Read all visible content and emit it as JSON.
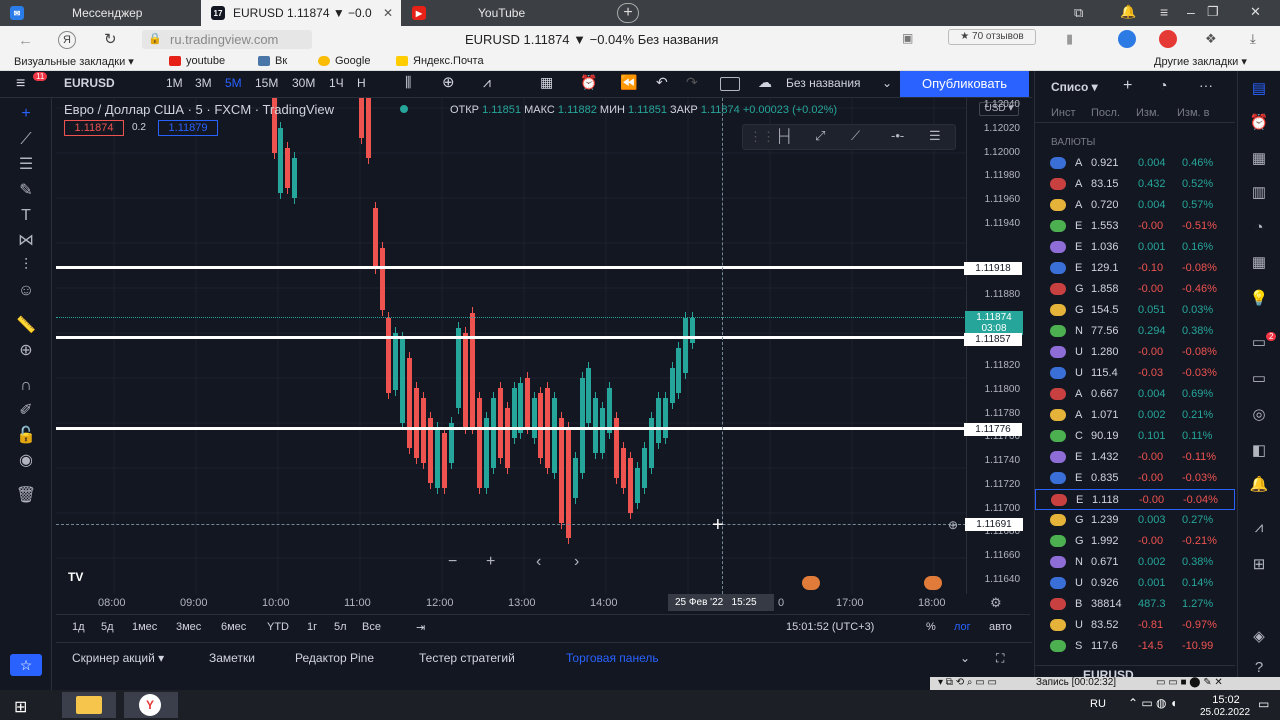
{
  "browser": {
    "tabs": [
      {
        "label": "Мессенджер",
        "active": false
      },
      {
        "label": "EURUSD 1.11874 ▼ −0.0",
        "active": true
      },
      {
        "label": "YouTube",
        "active": false
      }
    ],
    "url": "ru.tradingview.com",
    "page_title": "EURUSD 1.11874 ▼ −0.04% Без названия",
    "reviews": "★ 70 отзывов",
    "bookmarks": [
      "Визуальные закладки ▾",
      "youtube",
      "Вк",
      "Google",
      "Яндекс.Почта"
    ],
    "other_bookmarks": "Другие закладки ▾"
  },
  "toolbar": {
    "symbol": "EURUSD",
    "intervals": [
      "1M",
      "3M",
      "5M",
      "15M",
      "30M",
      "1Ч",
      "Н"
    ],
    "active_interval": "5M",
    "layout_name": "Без названия",
    "publish_label": "Опубликовать",
    "notif_badge": "11"
  },
  "legend": {
    "title": "Евро / Доллар США · 5 · FXCM · TradingView",
    "open_label": "ОТКР",
    "open": "1.11851",
    "high_label": "МАКС",
    "high": "1.11882",
    "low_label": "МИН",
    "low": "1.11851",
    "close_label": "ЗАКР",
    "close": "1.11874",
    "change": "+0.00023 (+0.02%)",
    "bid": "1.11874",
    "spread": "0.2",
    "ask": "1.11879"
  },
  "price_axis": {
    "currency": "USD ▾",
    "labels": [
      "1.12040",
      "1.12020",
      "1.12000",
      "1.11980",
      "1.11960",
      "1.11940",
      "1.11900",
      "1.11880",
      "1.11840",
      "1.11820",
      "1.11800",
      "1.11780",
      "1.11760",
      "1.11740",
      "1.11720",
      "1.11700",
      "1.11680",
      "1.11660",
      "1.11640"
    ],
    "current_price": "1.11874",
    "countdown": "03:08",
    "crosshair_price": "1.11691",
    "level_labels": [
      "1.11918",
      "1.11857",
      "1.11776"
    ]
  },
  "time_axis": {
    "labels": [
      "08:00",
      "09:00",
      "10:00",
      "11:00",
      "12:00",
      "13:00",
      "14:00",
      "0",
      "17:00",
      "18:00"
    ],
    "cursor_date": "25 Фев '22",
    "cursor_time": "15:25"
  },
  "range_bar": {
    "ranges": [
      "1д",
      "5д",
      "1мес",
      "3мес",
      "6мес",
      "YTD",
      "1г",
      "5л",
      "Все"
    ],
    "clock": "15:01:52 (UTC+3)",
    "percent": "%",
    "log": "лог",
    "auto": "авто"
  },
  "bottom_tabs": [
    "Скринер акций ▾",
    "Заметки",
    "Редактор Pine",
    "Тестер стратегий",
    "Торговая панель"
  ],
  "watchlist": {
    "title": "Списо ▾",
    "columns": [
      "Инст",
      "Посл.",
      "Изм.",
      "Изм. в"
    ],
    "section": "ВАЛЮТЫ",
    "rows": [
      {
        "sym": "A",
        "last": "0.921",
        "chg": "0.004",
        "pct": "0.46%",
        "up": true
      },
      {
        "sym": "A",
        "last": "83.15",
        "chg": "0.432",
        "pct": "0.52%",
        "up": true
      },
      {
        "sym": "A",
        "last": "0.720",
        "chg": "0.004",
        "pct": "0.57%",
        "up": true
      },
      {
        "sym": "E",
        "last": "1.553",
        "chg": "-0.00",
        "pct": "-0.51%",
        "up": false
      },
      {
        "sym": "E",
        "last": "1.036",
        "chg": "0.001",
        "pct": "0.16%",
        "up": true
      },
      {
        "sym": "E",
        "last": "129.1",
        "chg": "-0.10",
        "pct": "-0.08%",
        "up": false
      },
      {
        "sym": "G",
        "last": "1.858",
        "chg": "-0.00",
        "pct": "-0.46%",
        "up": false
      },
      {
        "sym": "G",
        "last": "154.5",
        "chg": "0.051",
        "pct": "0.03%",
        "up": true
      },
      {
        "sym": "N",
        "last": "77.56",
        "chg": "0.294",
        "pct": "0.38%",
        "up": true
      },
      {
        "sym": "U",
        "last": "1.280",
        "chg": "-0.00",
        "pct": "-0.08%",
        "up": false
      },
      {
        "sym": "U",
        "last": "115.4",
        "chg": "-0.03",
        "pct": "-0.03%",
        "up": false
      },
      {
        "sym": "A",
        "last": "0.667",
        "chg": "0.004",
        "pct": "0.69%",
        "up": true
      },
      {
        "sym": "A",
        "last": "1.071",
        "chg": "0.002",
        "pct": "0.21%",
        "up": true
      },
      {
        "sym": "C",
        "last": "90.19",
        "chg": "0.101",
        "pct": "0.11%",
        "up": true
      },
      {
        "sym": "E",
        "last": "1.432",
        "chg": "-0.00",
        "pct": "-0.11%",
        "up": false
      },
      {
        "sym": "E",
        "last": "0.835",
        "chg": "-0.00",
        "pct": "-0.03%",
        "up": false
      },
      {
        "sym": "E",
        "last": "1.118",
        "chg": "-0.00",
        "pct": "-0.04%",
        "up": false,
        "selected": true
      },
      {
        "sym": "G",
        "last": "1.239",
        "chg": "0.003",
        "pct": "0.27%",
        "up": true
      },
      {
        "sym": "G",
        "last": "1.992",
        "chg": "-0.00",
        "pct": "-0.21%",
        "up": false
      },
      {
        "sym": "N",
        "last": "0.671",
        "chg": "0.002",
        "pct": "0.38%",
        "up": true
      },
      {
        "sym": "U",
        "last": "0.926",
        "chg": "0.001",
        "pct": "0.14%",
        "up": true
      },
      {
        "sym": "B",
        "last": "38814",
        "chg": "487.3",
        "pct": "1.27%",
        "up": true
      },
      {
        "sym": "U",
        "last": "83.52",
        "chg": "-0.81",
        "pct": "-0.97%",
        "up": false
      },
      {
        "sym": "S",
        "last": "117.6",
        "chg": "-14.5",
        "pct": "-10.99",
        "up": false
      }
    ],
    "footer_symbol": "EURUSD"
  },
  "right_badge": "2",
  "recorder": "Запись [00:02:32]",
  "taskbar": {
    "lang": "RU",
    "time": "15:02",
    "date": "25.02.2022"
  },
  "colors": {
    "bg": "#131722",
    "up": "#26a69a",
    "down": "#ef5350",
    "accent": "#2962ff"
  }
}
